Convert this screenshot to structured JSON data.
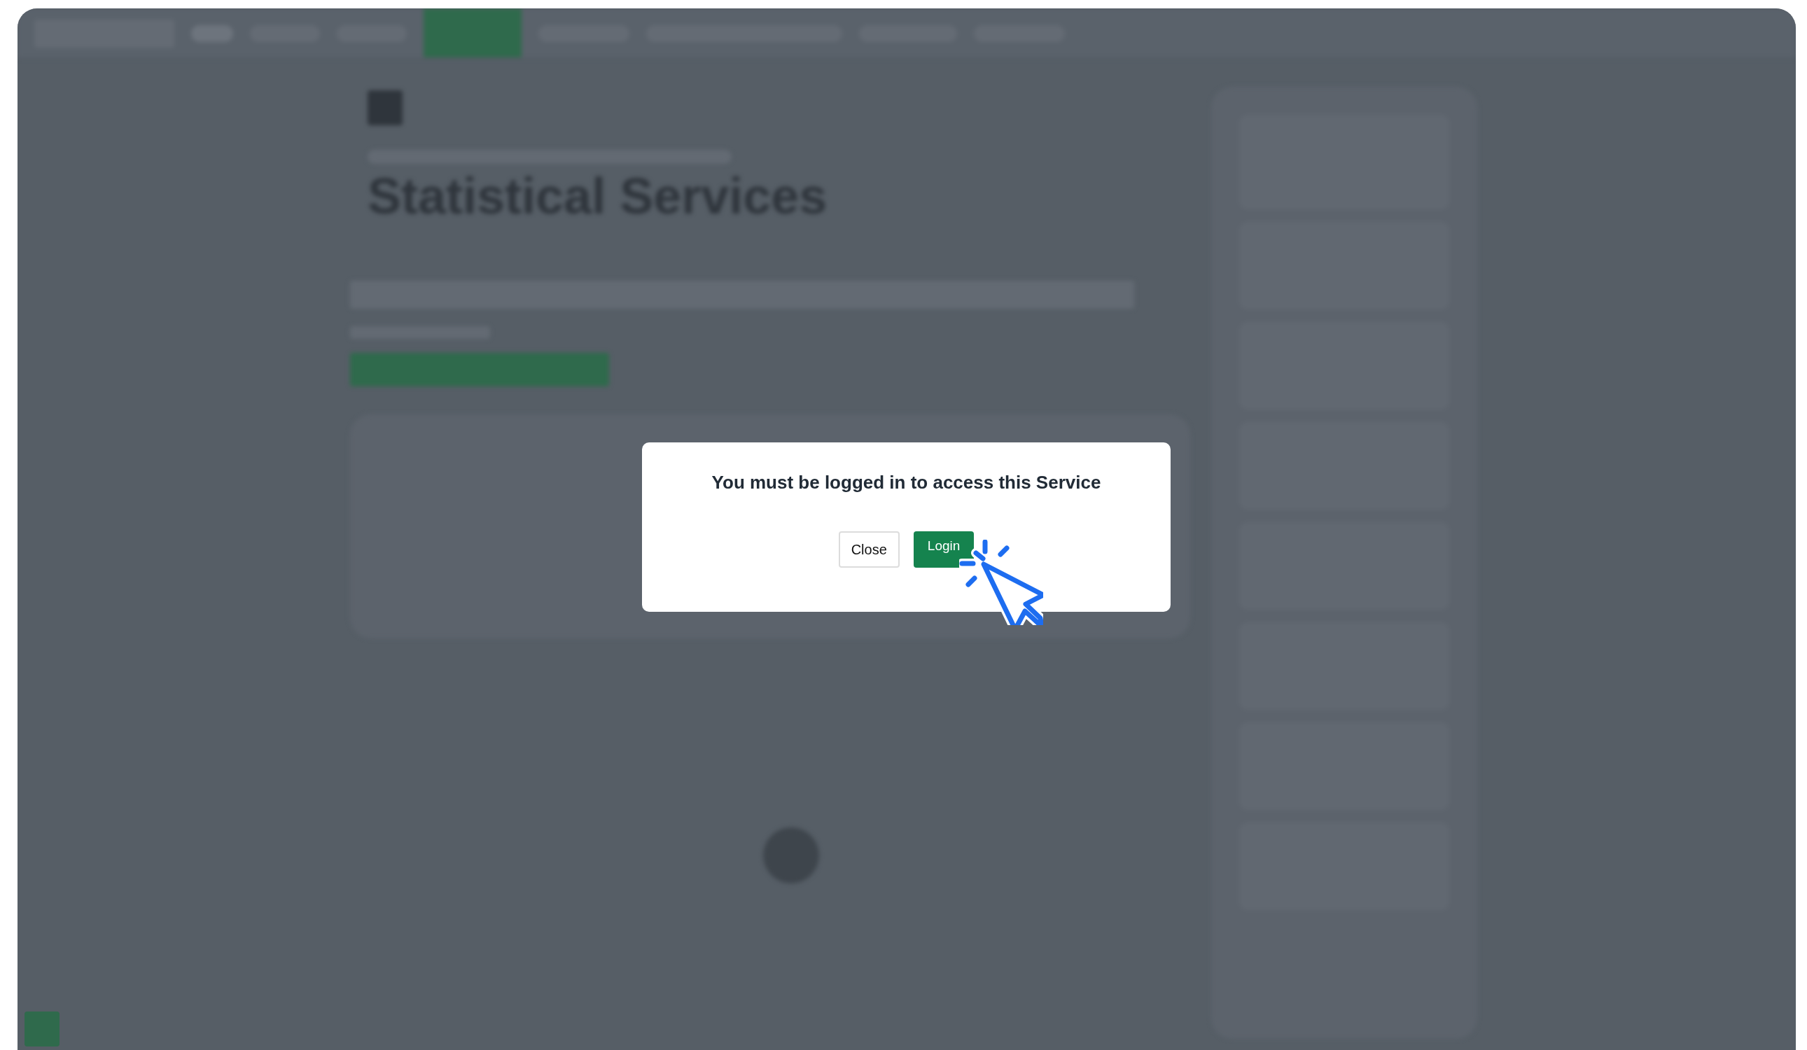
{
  "background": {
    "heading": "Statistical Services"
  },
  "dialog": {
    "message": "You must be logged in to access this Service",
    "buttons": [
      {
        "label": "Close",
        "kind": "secondary"
      },
      {
        "label": "Login",
        "kind": "primary"
      }
    ]
  }
}
